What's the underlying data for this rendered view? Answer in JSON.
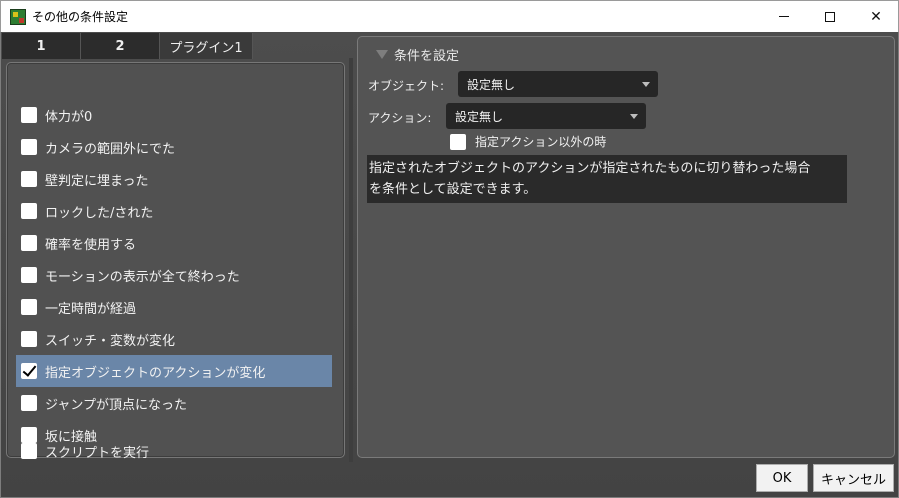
{
  "window": {
    "title": "その他の条件設定"
  },
  "tabs": [
    {
      "label": "1"
    },
    {
      "label": "2"
    },
    {
      "label": "プラグイン1"
    }
  ],
  "conditions": [
    {
      "label": "体力が0",
      "checked": false
    },
    {
      "label": "カメラの範囲外にでた",
      "checked": false
    },
    {
      "label": "壁判定に埋まった",
      "checked": false
    },
    {
      "label": "ロックした/された",
      "checked": false
    },
    {
      "label": "確率を使用する",
      "checked": false
    },
    {
      "label": "モーションの表示が全て終わった",
      "checked": false
    },
    {
      "label": "一定時間が経過",
      "checked": false
    },
    {
      "label": "スイッチ・変数が変化",
      "checked": false
    },
    {
      "label": "指定オブジェクトのアクションが変化",
      "checked": true,
      "selected": true
    },
    {
      "label": "ジャンプが頂点になった",
      "checked": false
    },
    {
      "label": "坂に接触",
      "checked": false
    },
    {
      "label": "スクリプトを実行",
      "checked": false
    }
  ],
  "settings": {
    "section_title": "条件を設定",
    "object_label": "オブジェクト:",
    "object_value": "設定無し",
    "action_label": "アクション:",
    "action_value": "設定無し",
    "except_label": "指定アクション以外の時",
    "description_line1": "指定されたオブジェクトのアクションが指定されたものに切り替わった場合",
    "description_line2": "を条件として設定できます。"
  },
  "buttons": {
    "ok": "OK",
    "cancel": "キャンセル"
  },
  "colors": {
    "selection": "#6a86a8",
    "panel": "#545454",
    "field_bg": "#262626"
  }
}
